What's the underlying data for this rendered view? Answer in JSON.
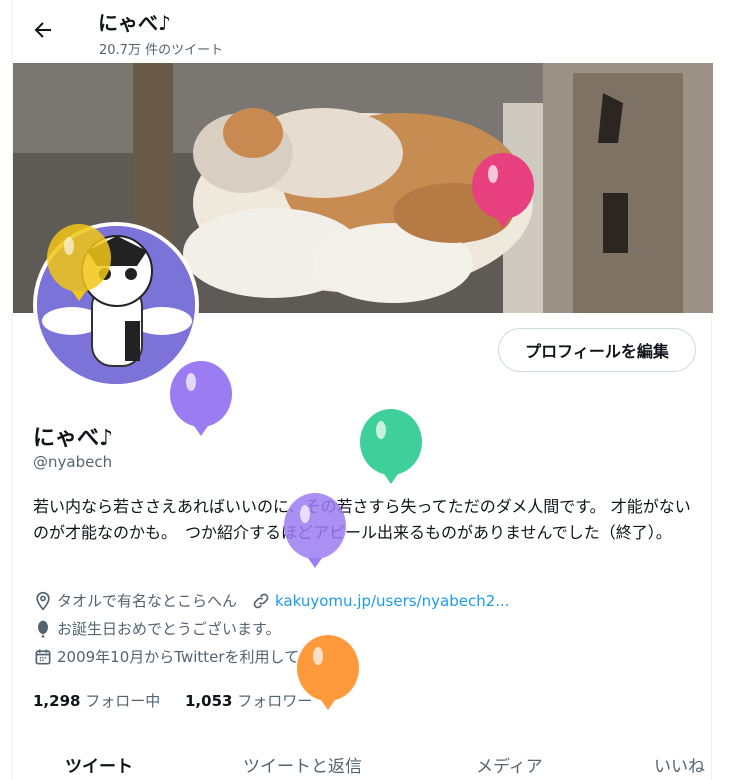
{
  "header": {
    "back_icon": "arrow-left-icon",
    "title": "にゃべ♪",
    "tweet_count": "20.7万 件のツイート"
  },
  "profile": {
    "edit_button": "プロフィールを編集",
    "display_name": "にゃべ♪",
    "handle": "@nyabech",
    "bio": "若い内なら若ささえあればいいのに、その若さすら失ってただのダメ人間です。 才能がないのが才能なのかも。　つか紹介するほどアピール出来るものがありませんでした（終了）。",
    "location": "タオルで有名なとこらへん",
    "website": "kakuyomu.jp/users/nyabech2...",
    "birthday": "お誕生日おめでとうございます。",
    "joined": "2009年10月からTwitterを利用しています",
    "following_count": "1,298",
    "following_label": "フォロー中",
    "followers_count": "1,053",
    "followers_label": "フォロワー"
  },
  "tabs": [
    {
      "label": "ツイート",
      "active": true
    },
    {
      "label": "ツイートと返信",
      "active": false
    },
    {
      "label": "メディア",
      "active": false
    },
    {
      "label": "いいね",
      "active": false
    }
  ],
  "colors": {
    "accent": "#1d9bf0",
    "balloon_pink": "#e8407f",
    "balloon_yellow": "#f2c516",
    "balloon_purple": "#9c7cf2",
    "balloon_green": "#3fcf9a",
    "balloon_orange": "#ff9a3c"
  },
  "icons": [
    "location-icon",
    "link-icon",
    "balloon-icon",
    "calendar-icon"
  ]
}
